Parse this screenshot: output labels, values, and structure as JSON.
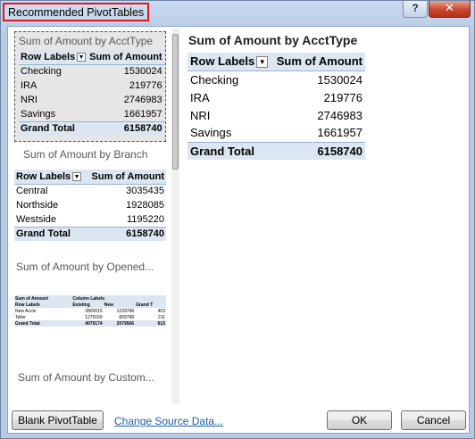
{
  "window": {
    "title": "Recommended PivotTables",
    "help_label": "?",
    "close_label": "✕"
  },
  "recommendations": [
    {
      "title": "Sum of Amount by AcctType",
      "headers": [
        "Row Labels",
        "Sum of Amount"
      ],
      "rows": [
        [
          "Checking",
          "1530024"
        ],
        [
          "IRA",
          "219776"
        ],
        [
          "NRI",
          "2746983"
        ],
        [
          "Savings",
          "1661957"
        ]
      ],
      "total": [
        "Grand Total",
        "6158740"
      ]
    },
    {
      "title": "Sum of Amount by Branch",
      "headers": [
        "Row Labels",
        "Sum of Amount"
      ],
      "rows": [
        [
          "Central",
          "3035435"
        ],
        [
          "Northside",
          "1928085"
        ],
        [
          "Westside",
          "1195220"
        ]
      ],
      "total": [
        "Grand Total",
        "6158740"
      ]
    },
    {
      "title": "Sum of Amount by Opened...",
      "top_headers": [
        "Sum of Amount",
        "Column Labels"
      ],
      "headers": [
        "Row Labels",
        "Existing",
        "New",
        "Grand T"
      ],
      "rows": [
        [
          "New Accts",
          "2800015",
          "1239768",
          "403"
        ],
        [
          "Teller",
          "1279159",
          "839798",
          "211"
        ]
      ],
      "total": [
        "Grand Total",
        "4079174",
        "2079566",
        "615"
      ]
    },
    {
      "title": "Sum of Amount by Custom..."
    }
  ],
  "preview": {
    "title": "Sum of Amount by AcctType",
    "headers": [
      "Row Labels",
      "Sum of Amount"
    ],
    "rows": [
      [
        "Checking",
        "1530024"
      ],
      [
        "IRA",
        "219776"
      ],
      [
        "NRI",
        "2746983"
      ],
      [
        "Savings",
        "1661957"
      ]
    ],
    "total": [
      "Grand Total",
      "6158740"
    ]
  },
  "footer": {
    "blank_label": "Blank PivotTable",
    "change_source_label": "Change Source Data...",
    "ok_label": "OK",
    "cancel_label": "Cancel"
  },
  "icons": {
    "dropdown": "▼"
  },
  "colors": {
    "table_header_bg": "#dce6f1",
    "title_highlight": "#e0181e",
    "link": "#1c5fa8"
  }
}
